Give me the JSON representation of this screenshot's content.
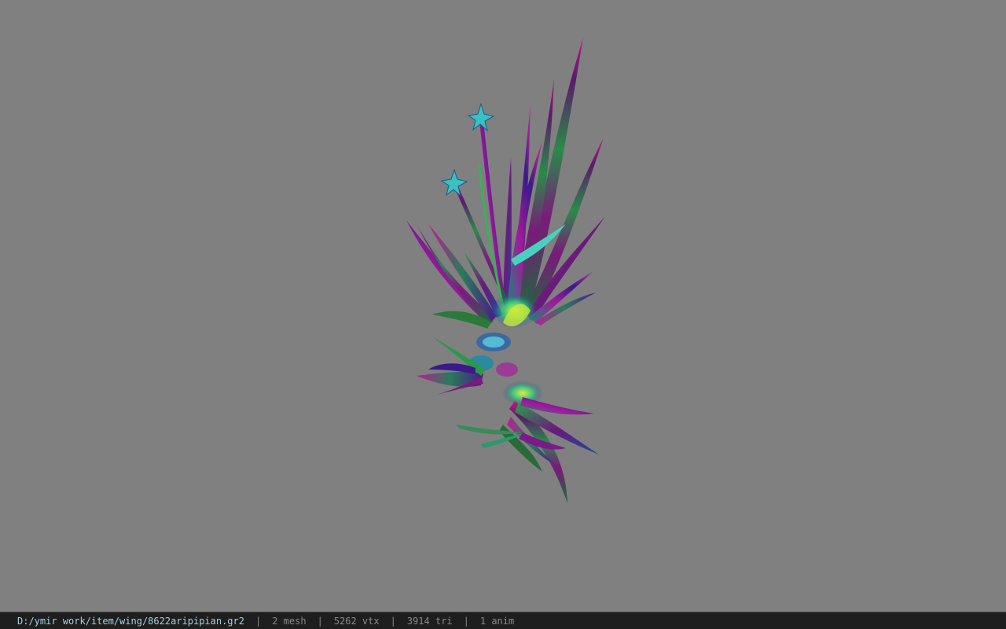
{
  "viewport": {
    "background_color": "#808080",
    "model_name": "wing-model-render"
  },
  "status_bar": {
    "file_path": "D:/ymir work/item/wing/8622aripipian.gr2",
    "separator": "|",
    "mesh_count": "2 mesh",
    "vertex_count": "5262 vtx",
    "triangle_count": "3914 tri",
    "anim_count": "1 anim",
    "path_color": "#9fd3e6",
    "text_color": "#8a8a8a",
    "background_color": "#1e1e1e"
  }
}
